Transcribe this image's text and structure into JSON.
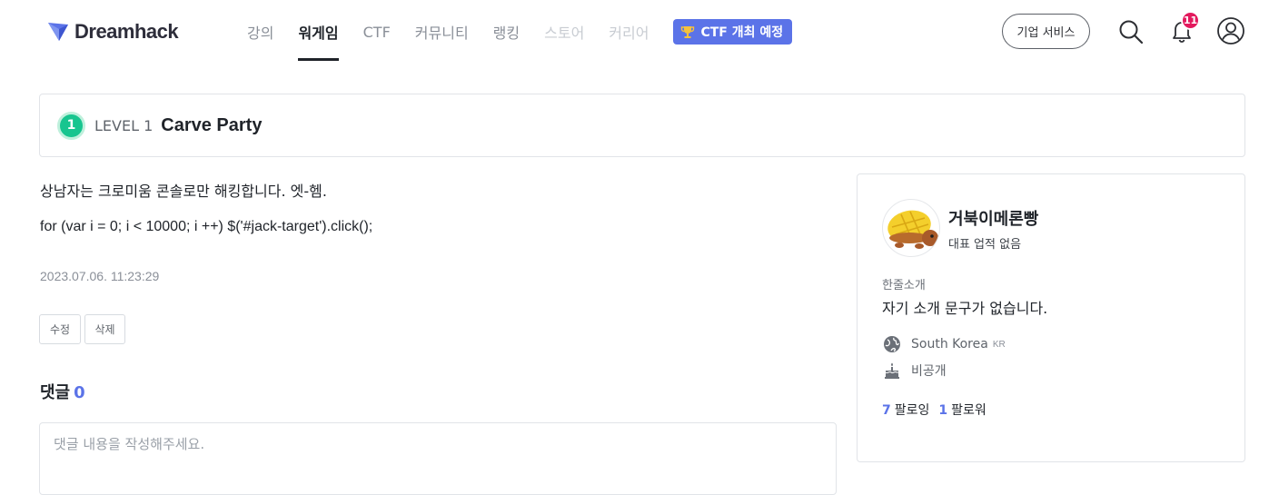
{
  "header": {
    "brand": "Dreamhack",
    "nav": [
      {
        "label": "강의"
      },
      {
        "label": "워게임"
      },
      {
        "label": "CTF"
      },
      {
        "label": "커뮤니티"
      },
      {
        "label": "랭킹"
      },
      {
        "label": "스토어"
      },
      {
        "label": "커리어"
      }
    ],
    "ctf_badge": "CTF 개최 예정",
    "enterprise_button": "기업 서비스",
    "notification_count": "11",
    "colors": {
      "accent": "#5b73e8",
      "badge": "#e3195d",
      "level": "#18c58f"
    }
  },
  "post": {
    "level_number": "1",
    "level_label": "LEVEL 1",
    "title": "Carve Party",
    "line1": "상남자는 크로미움 콘솔로만 해킹합니다. 엣-헴.",
    "line2": "for (var i = 0; i < 10000; i ++) $('#jack-target').click();",
    "date": "2023.07.06. 11:23:29",
    "edit_label": "수정",
    "delete_label": "삭제"
  },
  "comments": {
    "heading": "댓글",
    "count": "0",
    "placeholder": "댓글 내용을 작성해주세요."
  },
  "profile": {
    "username": "거북이메론빵",
    "achievement": "대표 업적 없음",
    "intro_label": "한줄소개",
    "intro_text": "자기 소개 문구가 없습니다.",
    "country": "South Korea",
    "country_code": "KR",
    "birthday": "비공개",
    "following_count": "7",
    "following_label": "팔로잉",
    "follower_count": "1",
    "follower_label": "팔로워"
  }
}
